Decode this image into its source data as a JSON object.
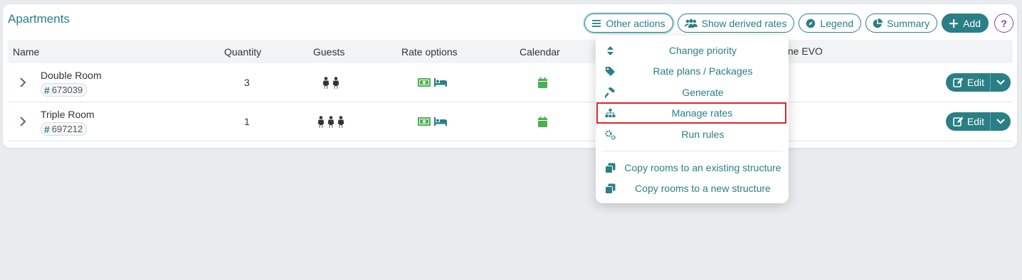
{
  "card": {
    "title": "Apartments"
  },
  "toolbar": {
    "other_actions": "Other actions",
    "show_derived": "Show derived rates",
    "legend": "Legend",
    "summary": "Summary",
    "add": "Add",
    "help": "?"
  },
  "columns": {
    "name": "Name",
    "quantity": "Quantity",
    "guests": "Guests",
    "rate_options": "Rate options",
    "calendar": "Calendar",
    "engine_partial": "gine EVO"
  },
  "rows": [
    {
      "name": "Double Room",
      "id": "673039",
      "quantity": "3",
      "guests": 2,
      "edit": "Edit"
    },
    {
      "name": "Triple Room",
      "id": "697212",
      "quantity": "1",
      "guests": 3,
      "edit": "Edit"
    }
  ],
  "menu": {
    "items": [
      {
        "label": "Change priority",
        "icon": "sort-icon"
      },
      {
        "label": "Rate plans / Packages",
        "icon": "tag-icon"
      },
      {
        "label": "Generate",
        "icon": "hammer-icon"
      },
      {
        "label": "Manage rates",
        "icon": "sitemap-icon"
      },
      {
        "label": "Run rules",
        "icon": "cogs-icon"
      },
      {
        "label": "Copy rooms to an existing structure",
        "icon": "copy-icon"
      },
      {
        "label": "Copy rooms to a new structure",
        "icon": "copy-icon"
      }
    ]
  },
  "colors": {
    "accent": "#2a7f86",
    "green": "#4caf50",
    "help": "#8b3fa3",
    "highlight": "#e02424"
  }
}
